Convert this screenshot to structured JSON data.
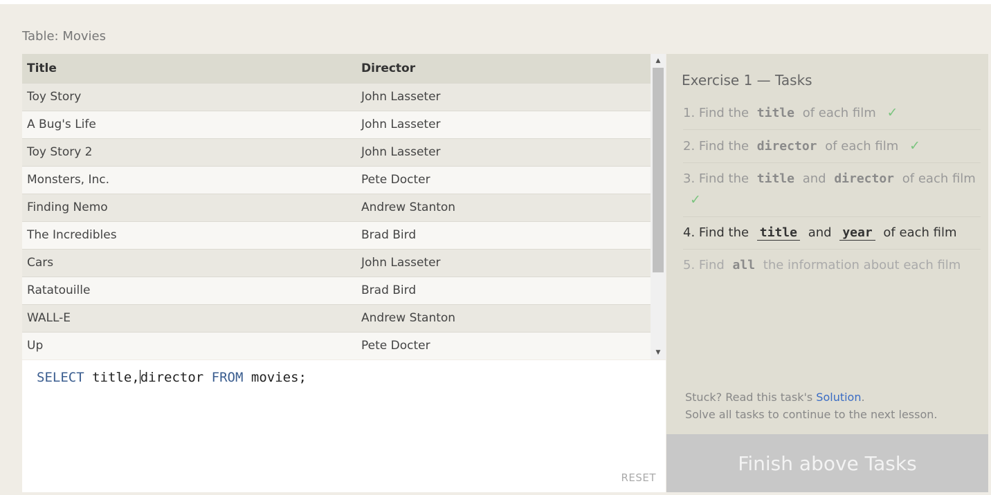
{
  "table_caption": "Table: Movies",
  "table": {
    "columns": [
      "Title",
      "Director"
    ],
    "rows": [
      [
        "Toy Story",
        "John Lasseter"
      ],
      [
        "A Bug's Life",
        "John Lasseter"
      ],
      [
        "Toy Story 2",
        "John Lasseter"
      ],
      [
        "Monsters, Inc.",
        "Pete Docter"
      ],
      [
        "Finding Nemo",
        "Andrew Stanton"
      ],
      [
        "The Incredibles",
        "Brad Bird"
      ],
      [
        "Cars",
        "John Lasseter"
      ],
      [
        "Ratatouille",
        "Brad Bird"
      ],
      [
        "WALL-E",
        "Andrew Stanton"
      ],
      [
        "Up",
        "Pete Docter"
      ]
    ]
  },
  "editor": {
    "kw_select": "SELECT",
    "part1": " title,",
    "part2": "director ",
    "kw_from": "FROM",
    "part3": " movies;",
    "reset_label": "RESET"
  },
  "tasks": {
    "title": "Exercise 1 — Tasks",
    "items": [
      {
        "num": "1.",
        "a": "Find the",
        "k1": "title",
        "b": "of each film",
        "check": "✓"
      },
      {
        "num": "2.",
        "a": "Find the",
        "k1": "director",
        "b": "of each film",
        "check": "✓"
      },
      {
        "num": "3.",
        "a": "Find the",
        "k1": "title",
        "mid": "and",
        "k2": "director",
        "b": "of each film",
        "check": "✓"
      },
      {
        "num": "4.",
        "a": "Find the",
        "k1": "title",
        "mid": "and",
        "k2": "year",
        "b": "of each film"
      },
      {
        "num": "5.",
        "a": "Find",
        "k1": "all",
        "b": "the information about each film"
      }
    ],
    "stuck_text": "Stuck? Read this task's",
    "solution_link": "Solution",
    "stuck_period": ".",
    "continue_text": "Solve all tasks to continue to the next lesson."
  },
  "finish_button": "Finish above Tasks",
  "colors": {
    "accent_link": "#3a6cc4",
    "check": "#7bc47f",
    "keyword": "#3a5d8f"
  }
}
